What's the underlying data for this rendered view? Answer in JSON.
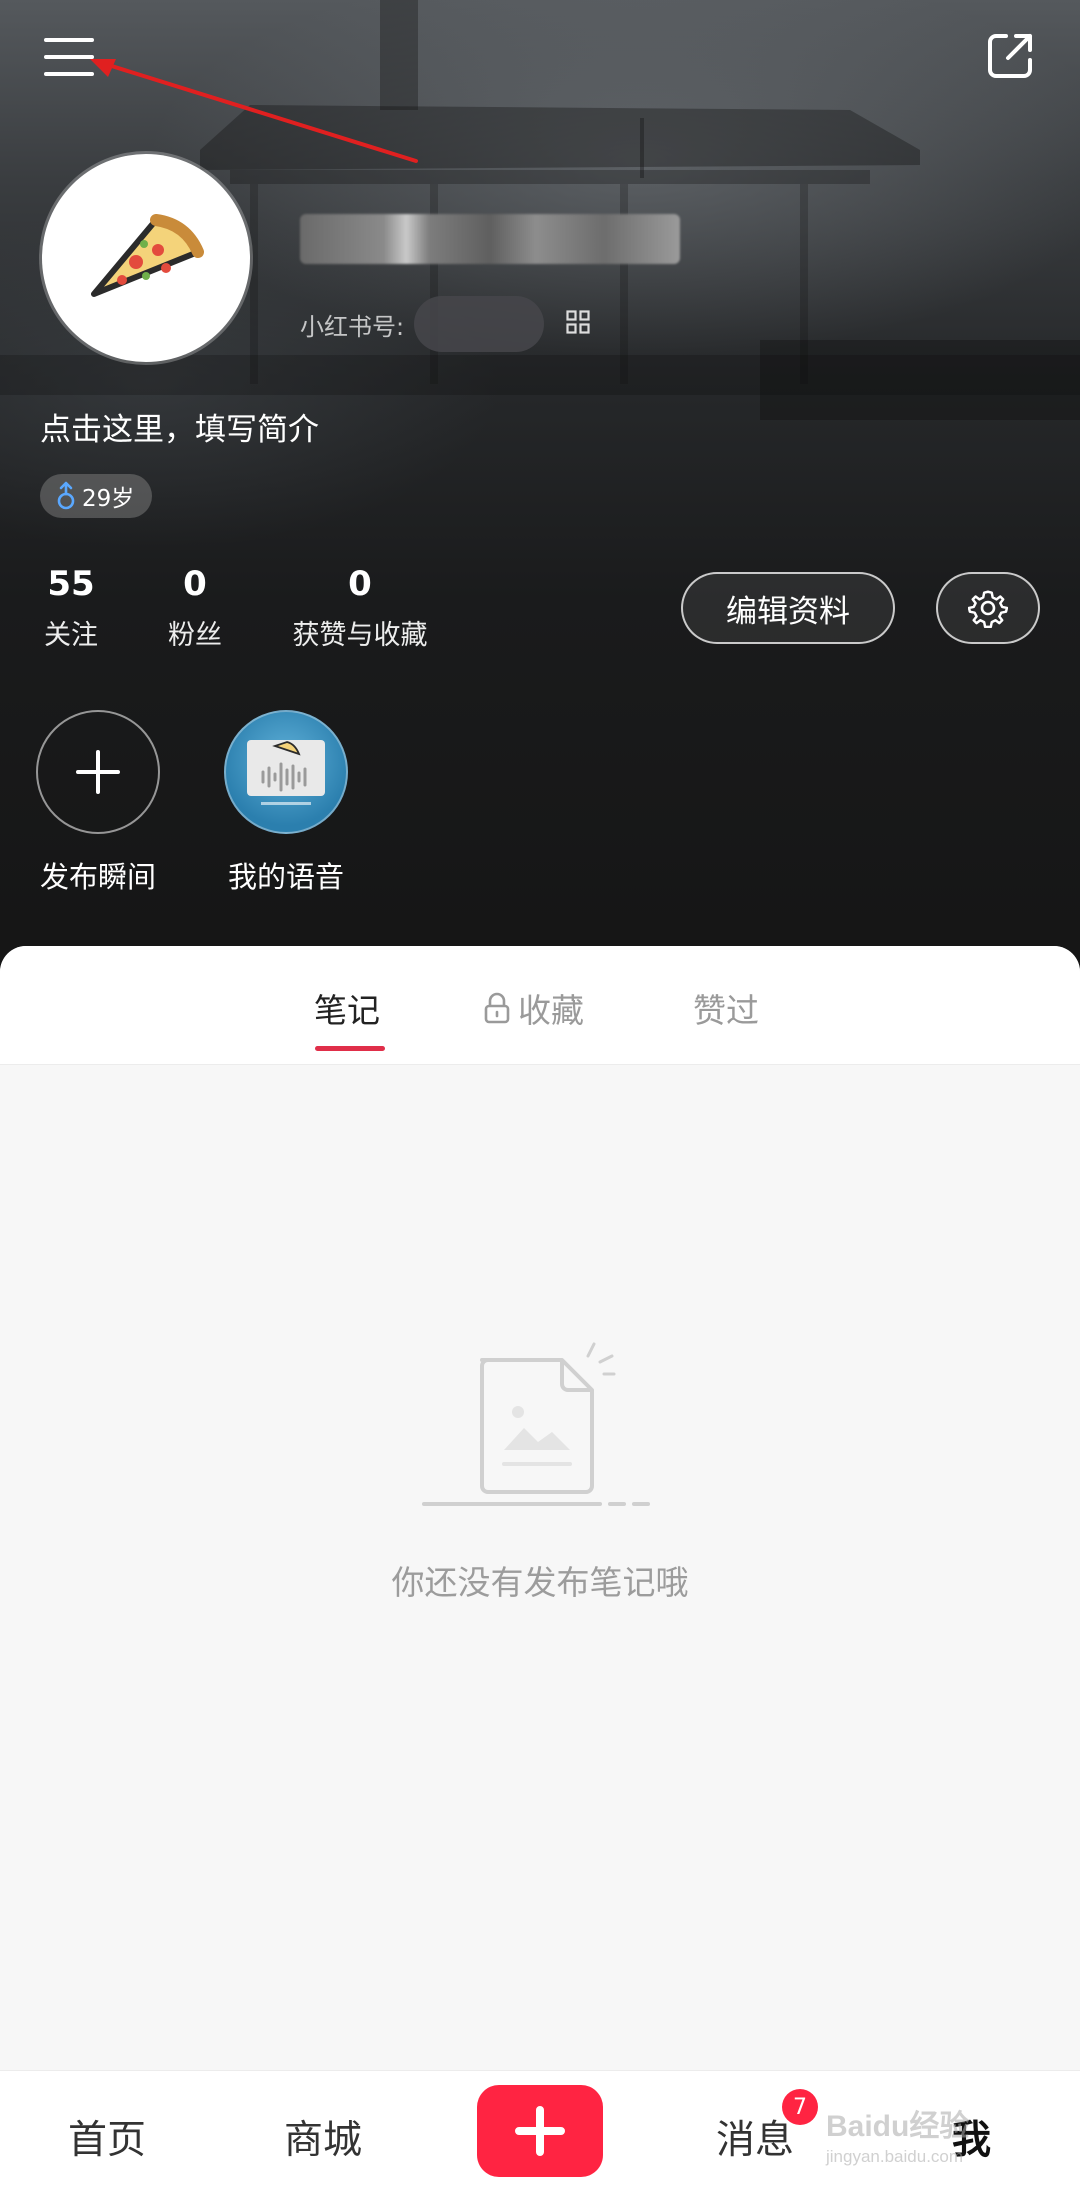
{
  "profile": {
    "id_label": "小红书号:",
    "bio_prompt": "点击这里，填写简介",
    "age_tag": "29岁"
  },
  "stats": [
    {
      "value": "55",
      "label": "关注"
    },
    {
      "value": "0",
      "label": "粉丝"
    },
    {
      "value": "0",
      "label": "获赞与收藏"
    }
  ],
  "actions": {
    "edit_profile": "编辑资料"
  },
  "moments": [
    {
      "label": "发布瞬间"
    },
    {
      "label": "我的语音"
    }
  ],
  "tabs": [
    {
      "label": "笔记",
      "active": true
    },
    {
      "label": "收藏",
      "locked": true
    },
    {
      "label": "赞过"
    }
  ],
  "empty_state": {
    "text": "你还没有发布笔记哦"
  },
  "bottom_nav": {
    "home": "首页",
    "mall": "商城",
    "messages": "消息",
    "me": "我",
    "messages_badge": "7"
  },
  "watermark": {
    "brand": "Baidu经验",
    "url": "jingyan.baidu.com"
  },
  "colors": {
    "accent": "#ff2442",
    "tab_underline": "#e02e49",
    "age_icon": "#5aa8ff"
  }
}
